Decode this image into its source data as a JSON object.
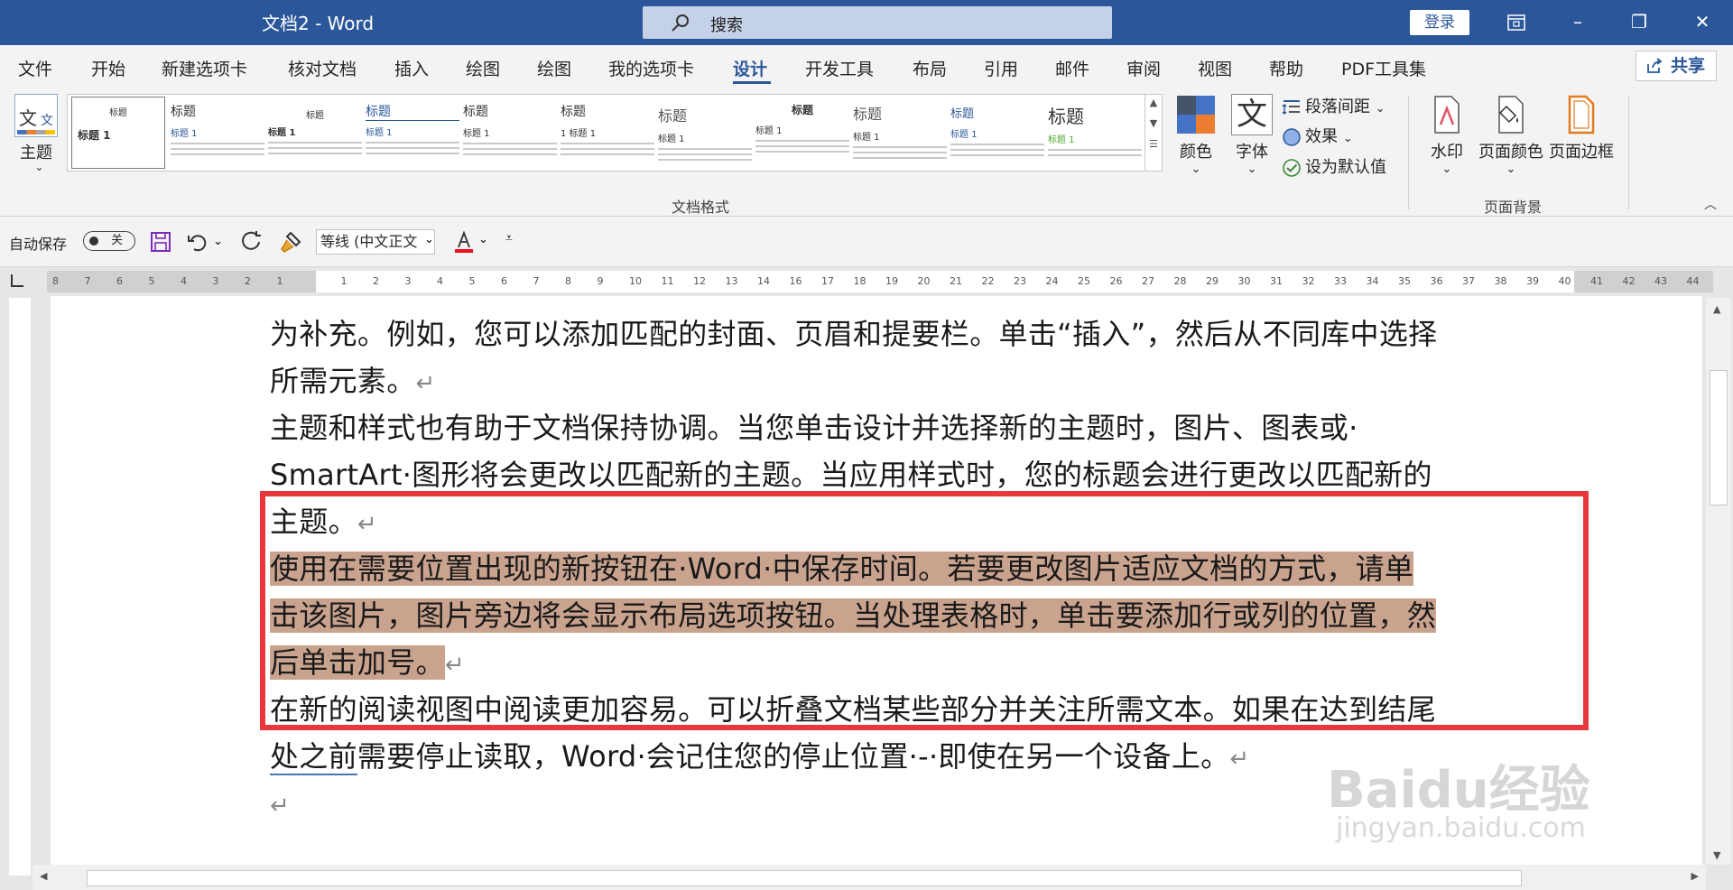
{
  "window": {
    "title": "文档2 - Word",
    "search_placeholder": "搜索",
    "login_label": "登录",
    "restore_ribbon_icon": "ribbon-display-icon",
    "minimize": "–",
    "maximize": "❐",
    "close": "✕"
  },
  "menu": {
    "items": [
      "文件",
      "开始",
      "新建选项卡",
      "核对文档",
      "插入",
      "绘图",
      "绘图",
      "我的选项卡",
      "设计",
      "开发工具",
      "布局",
      "引用",
      "邮件",
      "审阅",
      "视图",
      "帮助",
      "PDF工具集"
    ],
    "active": "设计",
    "share_label": "共享"
  },
  "ribbon": {
    "theme_label": "主题",
    "style_gallery": [
      {
        "title": "标题",
        "sub": "标题 1"
      },
      {
        "title": "标题",
        "sub": "标题 1"
      },
      {
        "title": "标题",
        "sub": "标题 1"
      },
      {
        "title": "标题",
        "sub": "标题 1"
      },
      {
        "title": "标题",
        "sub": "标题 1"
      },
      {
        "title": "标题",
        "sub": "1  标题 1"
      },
      {
        "title": "标题",
        "sub": "标题 1"
      },
      {
        "title": "标题",
        "sub": "标题 1"
      },
      {
        "title": "标题",
        "sub": "标题 1"
      },
      {
        "title": "标题",
        "sub": "标题 1"
      },
      {
        "title": "标题",
        "sub": "标题 1"
      }
    ],
    "gallery_group_label": "文档格式",
    "colors_label": "颜色",
    "fonts_label": "字体",
    "paragraph_spacing_label": "段落间距",
    "effects_label": "效果",
    "set_default_label": "设为默认值",
    "watermark_label": "水印",
    "page_color_label": "页面颜色",
    "page_border_label": "页面边框",
    "page_background_group_label": "页面背景"
  },
  "qat": {
    "autosave_label": "自动保存",
    "autosave_state": "关",
    "font_name": "等线 (中文正文"
  },
  "ruler": {
    "labels": [
      "8",
      "7",
      "6",
      "5",
      "4",
      "3",
      "2",
      "1",
      "",
      "1",
      "2",
      "3",
      "4",
      "5",
      "6",
      "7",
      "8",
      "9",
      "10",
      "11",
      "12",
      "13",
      "14",
      "16",
      "17",
      "18",
      "19",
      "20",
      "21",
      "22",
      "23",
      "24",
      "25",
      "26",
      "27",
      "28",
      "29",
      "30",
      "31",
      "32",
      "33",
      "34",
      "35",
      "36",
      "37",
      "38",
      "39",
      "40",
      "41",
      "42",
      "43",
      "44"
    ]
  },
  "document": {
    "line1": "为补充。例如，您可以添加匹配的封面、页眉和提要栏。单击“插入”，然后从不同库中选择",
    "line2": "所需元素。",
    "line3": "主题和样式也有助于文档保持协调。当您单击设计并选择新的主题时，图片、图表或·",
    "line4": "SmartArt·图形将会更改以匹配新的主题。当应用样式时，您的标题会进行更改以匹配新的",
    "line5": "主题。",
    "line6": "使用在需要位置出现的新按钮在·Word·中保存时间。若要更改图片适应文档的方式，请单",
    "line7": "击该图片，图片旁边将会显示布局选项按钮。当处理表格时，单击要添加行或列的位置，然",
    "line8": "后单击加号。",
    "line9": "在新的阅读视图中阅读更加容易。可以折叠文档某些部分并关注所需文本。如果在达到结尾",
    "line10_underlined": "处之前",
    "line10_rest": "需要停止读取，Word·会记住您的停止位置·-·即使在另一个设备上。",
    "para_mark": "↵"
  },
  "watermark": {
    "brand": "Baidu经验",
    "url": "jingyan.baidu.com"
  },
  "colors": {
    "title_bar": "#2b579a",
    "highlight": "#c9a38e",
    "annotation_box": "#e8383b"
  }
}
